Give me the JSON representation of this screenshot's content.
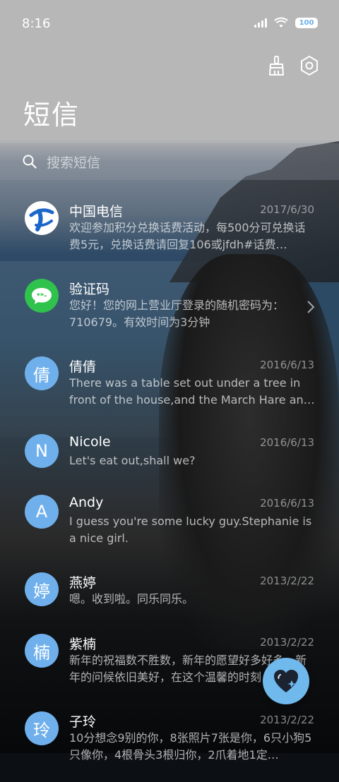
{
  "status": {
    "time": "8:16",
    "battery": "100"
  },
  "header": {
    "title": "短信"
  },
  "search": {
    "placeholder": "搜索短信"
  },
  "messages": [
    {
      "avatar_text": "",
      "name": "中国电信",
      "date": "2017/6/30",
      "preview": "欢迎参加积分兑换话费活动，每500分可兑换话费5元，兑换话费请回复106或jfdh#话费…"
    },
    {
      "avatar_text": "",
      "name": "验证码",
      "date": "",
      "preview": "您好！您的网上营业厅登录的随机密码为：710679。有效时间为3分钟"
    },
    {
      "avatar_text": "倩",
      "name": "倩倩",
      "date": "2016/6/13",
      "preview": "There was a table set out under a tree in front of the house,and the March Hare an…"
    },
    {
      "avatar_text": "N",
      "name": "Nicole",
      "date": "2016/6/13",
      "preview": "Let's eat out,shall we?"
    },
    {
      "avatar_text": "A",
      "name": "Andy",
      "date": "2016/6/13",
      "preview": "I guess you're some lucky guy.Stephanie is a nice girl."
    },
    {
      "avatar_text": "婷",
      "name": "燕婷",
      "date": "2013/2/22",
      "preview": "嗯。收到啦。同乐同乐。"
    },
    {
      "avatar_text": "楠",
      "name": "紫楠",
      "date": "2013/2/22",
      "preview": "新年的祝福数不胜数，新年的愿望好多好多，新年的问候依旧美好，在这个温馨的时刻，…"
    },
    {
      "avatar_text": "玲",
      "name": "子玲",
      "date": "2013/2/22",
      "preview": "10分想念9别的你，8张照片7张是你，6只小狗5只像你，4根骨头3根归你，2爪着地1定…"
    }
  ],
  "colors": {
    "accent": "#6fb0ec",
    "verify_green": "#2fc24c"
  },
  "icons": {
    "clean": "broom-icon",
    "settings": "gear-icon",
    "compose": "heart-compose-icon"
  }
}
